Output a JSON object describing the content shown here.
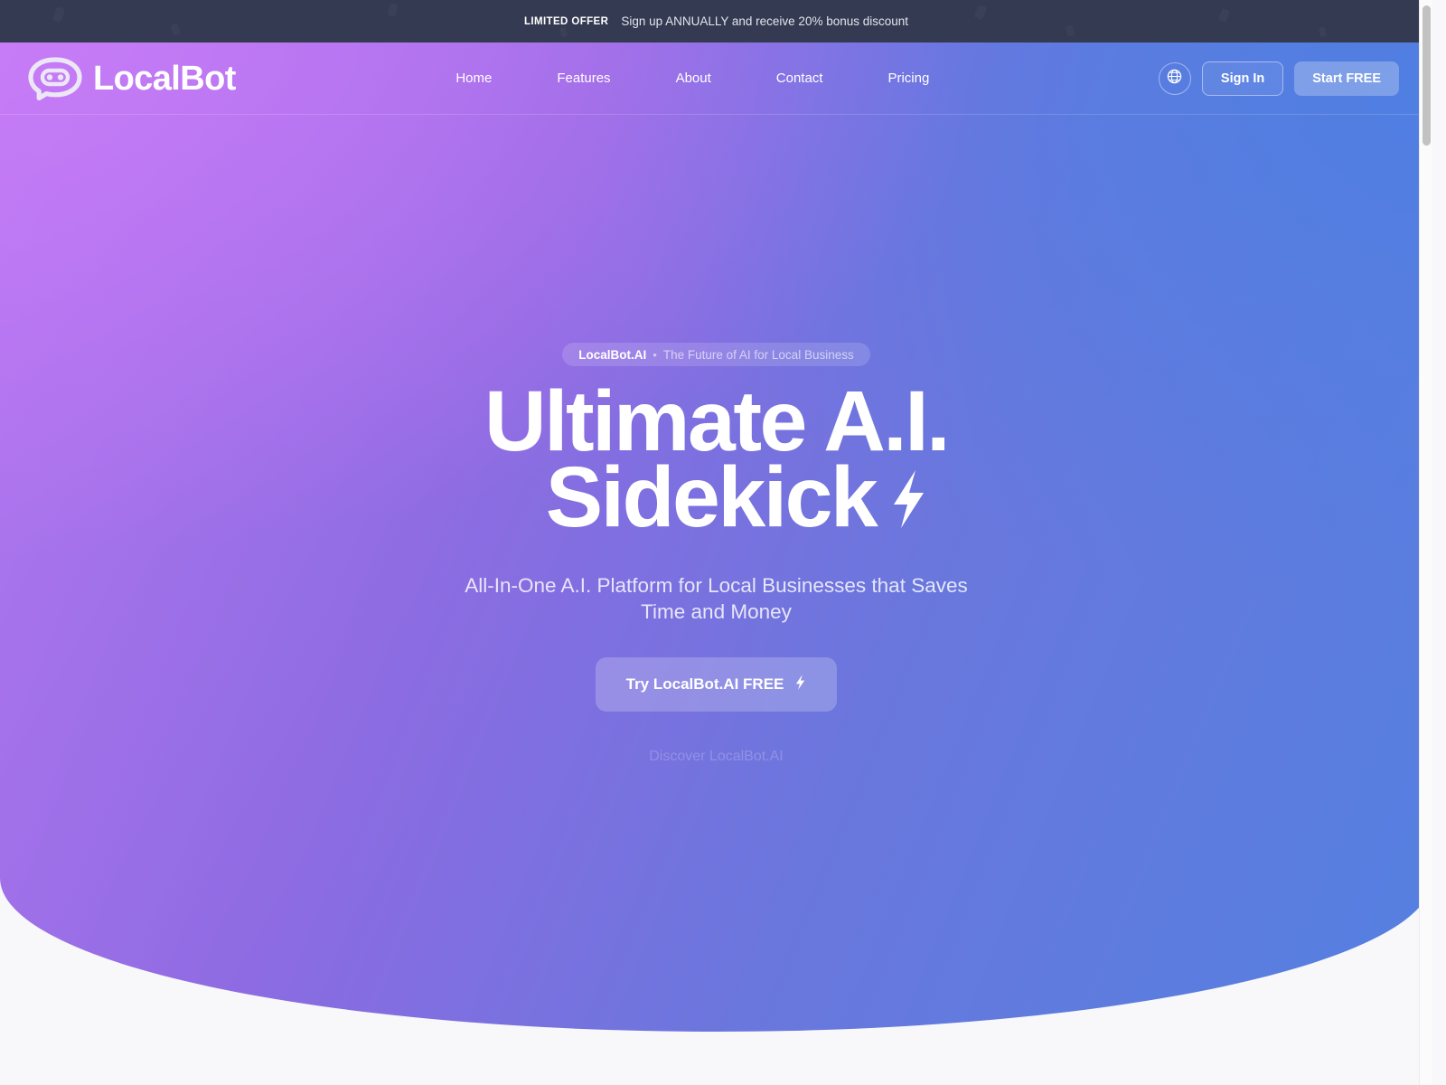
{
  "announcement": {
    "label": "LIMITED OFFER",
    "text": "Sign up ANNUALLY and receive 20% bonus discount"
  },
  "header": {
    "brand_name": "LocalBot",
    "brand_icon": "chat-bot-icon",
    "nav": [
      {
        "label": "Home"
      },
      {
        "label": "Features"
      },
      {
        "label": "About"
      },
      {
        "label": "Contact"
      },
      {
        "label": "Pricing"
      }
    ],
    "language_icon": "globe-icon",
    "sign_in_label": "Sign In",
    "start_free_label": "Start FREE"
  },
  "hero": {
    "badge": {
      "brand": "LocalBot.AI",
      "separator": "•",
      "tagline": "The Future of AI for Local Business"
    },
    "title_line1": "Ultimate A.I.",
    "title_line2": "Sidekick",
    "title_icon": "lightning-bolt-icon",
    "subtitle": "All-In-One A.I. Platform for Local Businesses that Saves Time and Money",
    "cta_label": "Try LocalBot.AI FREE",
    "cta_icon": "lightning-bolt-icon",
    "discover_label": "Discover LocalBot.AI"
  },
  "colors": {
    "banner_bg": "#343a51",
    "gradient_purple": "#b06ef0",
    "gradient_mid": "#8d6ae2",
    "gradient_blue": "#5380e0",
    "page_bg": "#f8f8fa",
    "text_white": "#ffffff"
  }
}
